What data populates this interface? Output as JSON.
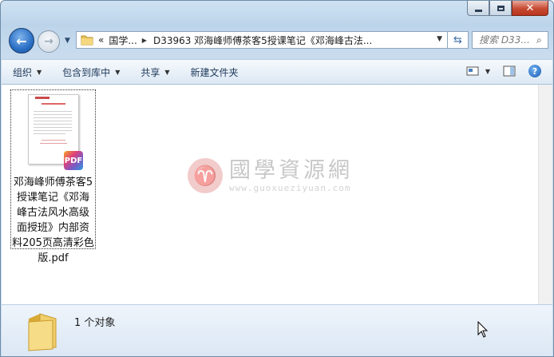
{
  "window": {
    "caption": {
      "minimize_icon": "minimize-icon",
      "maximize_icon": "maximize-icon",
      "close_glyph": "✕"
    }
  },
  "nav": {
    "back_icon": "back-arrow-icon",
    "forward_icon": "forward-arrow-icon",
    "breadcrumb_overflow": "«",
    "breadcrumb": [
      "国学...",
      "D33963 邓海峰师傅茶客5授课笔记《邓海峰古法..."
    ],
    "search_placeholder": "搜索 D33..."
  },
  "toolbar": {
    "organize": "组织",
    "include_in_library": "包含到库中",
    "share": "共享",
    "new_folder": "新建文件夹"
  },
  "files": [
    {
      "name": "邓海峰师傅茶客5授课笔记《邓海峰古法风水高级面授班》内部资料205页高清彩色版.pdf",
      "badge": "PDF"
    }
  ],
  "watermark": {
    "cn": "國學資源網",
    "url": "www.guoxueziyuan.com"
  },
  "status": {
    "count_text": "1 个对象"
  },
  "colors": {
    "accent": "#2a6fc4",
    "close_red": "#c74a32",
    "toolbar_text": "#1e395b"
  }
}
